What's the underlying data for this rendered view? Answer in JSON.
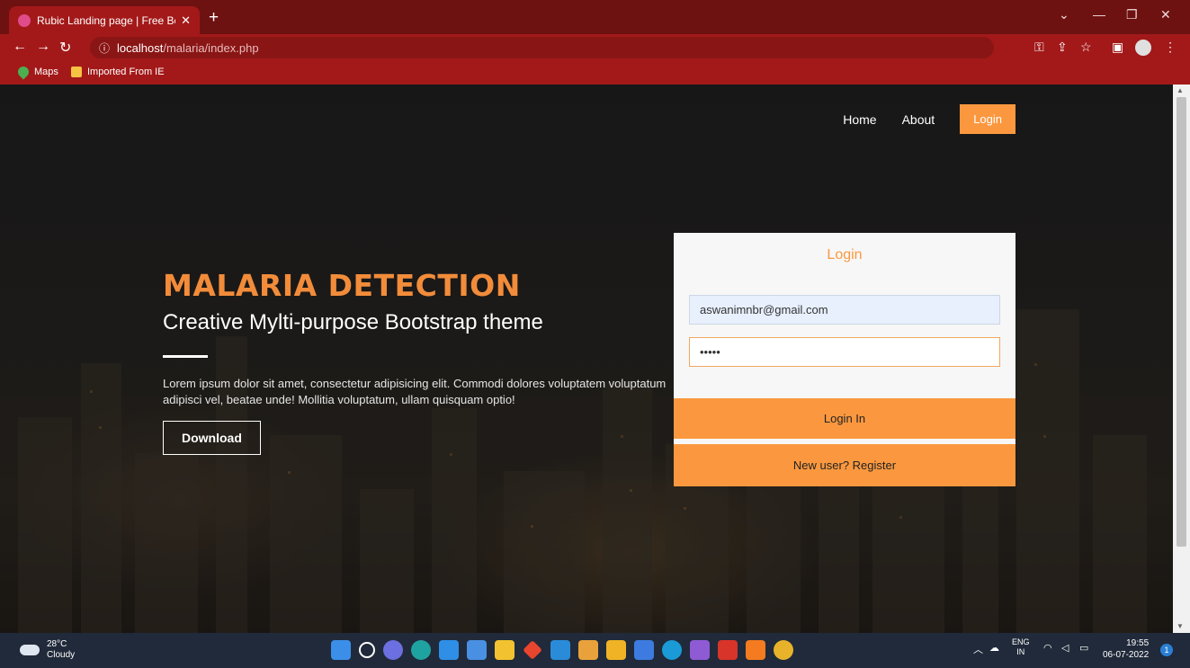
{
  "browser": {
    "tab_title": "Rubic Landing page | Free Bootst",
    "tab_close": "✕",
    "new_tab": "+",
    "url_host": "localhost",
    "url_path": "/malaria/index.php",
    "bookmarks": [
      "Maps",
      "Imported From IE"
    ]
  },
  "nav": {
    "home": "Home",
    "about": "About",
    "login": "Login"
  },
  "hero": {
    "title": "MALARIA DETECTION",
    "subtitle": "Creative Mylti-purpose Bootstrap theme",
    "body": "Lorem ipsum dolor sit amet, consectetur adipisicing elit. Commodi dolores voluptatem voluptatum adipisci vel, beatae unde! Mollitia voluptatum, ullam quisquam optio!",
    "button": "Download"
  },
  "login_card": {
    "title": "Login",
    "email_value": "aswanimnbr@gmail.com",
    "password_value": "•••••",
    "submit": "Login In",
    "register": "New user? Register"
  },
  "taskbar": {
    "temp": "28°C",
    "condition": "Cloudy",
    "lang_top": "ENG",
    "lang_bottom": "IN",
    "time": "19:55",
    "date": "06-07-2022",
    "notifications": "1"
  },
  "colors": {
    "accent": "#fb983f",
    "browser_frame": "#a31919",
    "taskbar": "#202a3a"
  }
}
